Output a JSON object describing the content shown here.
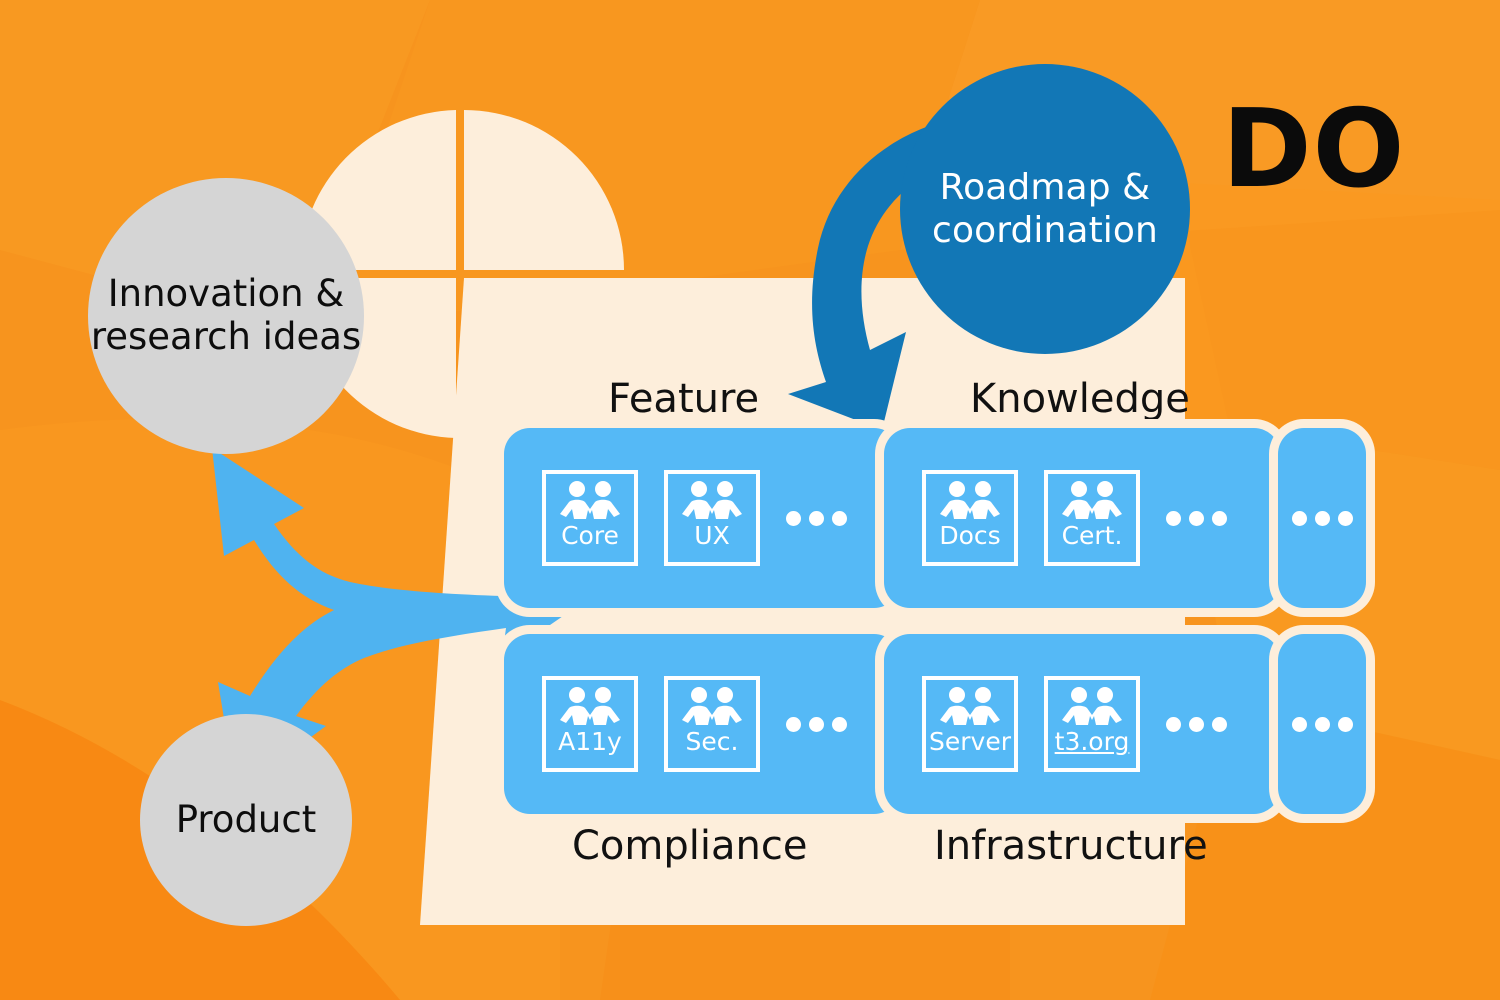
{
  "palette": {
    "background_orange": "#f7941e",
    "background_orange_dark": "#f4780c",
    "cream": "#fdeedb",
    "light_blue": "#55b9f6",
    "dark_blue": "#1277b6",
    "gray": "#d5d5d5",
    "black": "#0b0b0b",
    "white": "#ffffff"
  },
  "brand": {
    "wordmark": "DO"
  },
  "circles": {
    "innovation": "Innovation & research ideas",
    "product": "Product",
    "roadmap": "Roadmap & coordination"
  },
  "groups": [
    {
      "id": "feature",
      "label": "Feature",
      "teams": [
        {
          "name": "Core",
          "link": false
        },
        {
          "name": "UX",
          "link": false
        }
      ],
      "more": "..."
    },
    {
      "id": "knowledge",
      "label": "Knowledge",
      "teams": [
        {
          "name": "Docs",
          "link": false
        },
        {
          "name": "Cert.",
          "link": false
        }
      ],
      "more": "..."
    },
    {
      "id": "compliance",
      "label": "Compliance",
      "teams": [
        {
          "name": "A11y",
          "link": false
        },
        {
          "name": "Sec.",
          "link": false
        }
      ],
      "more": "..."
    },
    {
      "id": "infrastructure",
      "label": "Infrastructure",
      "teams": [
        {
          "name": "Server",
          "link": false
        },
        {
          "name": "t3.org",
          "link": true
        }
      ],
      "more": "..."
    }
  ],
  "extra_groups": {
    "top": "...",
    "bottom": "..."
  },
  "icons": {
    "team": "two-people-icon",
    "more": "ellipsis-icon",
    "arrow_split": "split-arrow-icon",
    "arrow_loop": "curved-loop-arrow-icon"
  }
}
